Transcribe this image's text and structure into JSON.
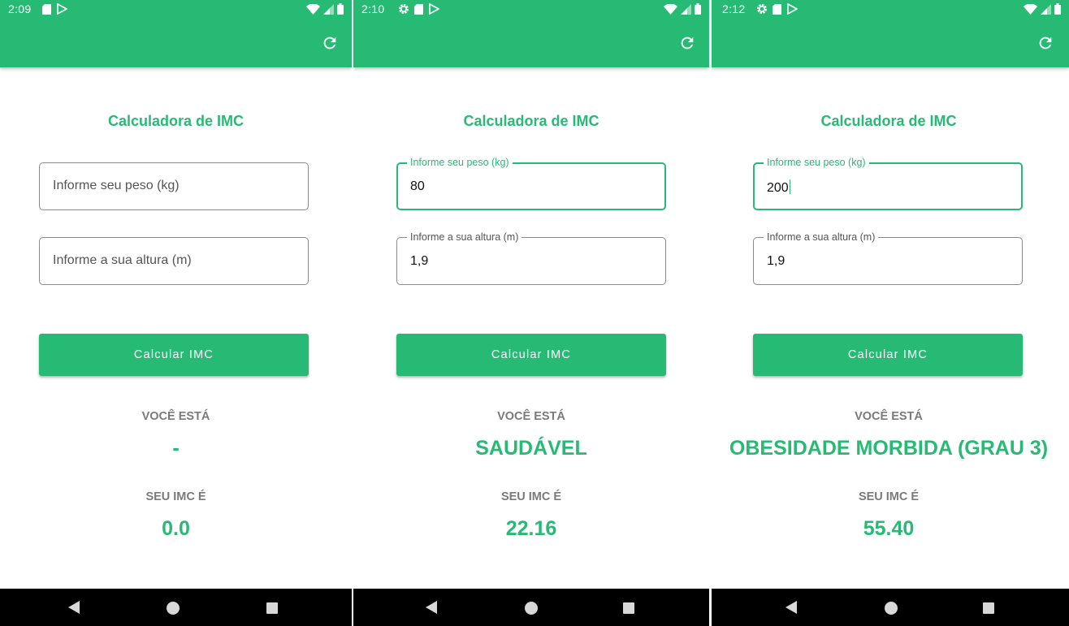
{
  "colors": {
    "primary": "#27ba74",
    "caption": "#7a7a7a",
    "navbar": "#000000"
  },
  "screens": [
    {
      "status_time": "2:09",
      "status_icons": [
        "sd-card-icon",
        "play-store-icon"
      ],
      "title": "Calculadora de IMC",
      "weight": {
        "placeholder": "Informe seu peso (kg)",
        "label": "",
        "value": "",
        "focused": false
      },
      "height": {
        "placeholder": "Informe a sua altura (m)",
        "label": "",
        "value": ""
      },
      "button": "Calcular IMC",
      "status_caption": "VOCÊ ESTÁ",
      "status_value": "-",
      "imc_caption": "SEU IMC É",
      "imc_value": "0.0"
    },
    {
      "status_time": "2:10",
      "status_icons": [
        "gear-icon",
        "sd-card-icon",
        "play-store-icon"
      ],
      "title": "Calculadora de IMC",
      "weight": {
        "placeholder": "",
        "label": "Informe seu peso (kg)",
        "value": "80",
        "focused": true
      },
      "height": {
        "placeholder": "",
        "label": "Informe a sua altura (m)",
        "value": "1,9"
      },
      "button": "Calcular IMC",
      "status_caption": "VOCÊ ESTÁ",
      "status_value": "SAUDÁVEL",
      "imc_caption": "SEU IMC É",
      "imc_value": "22.16"
    },
    {
      "status_time": "2:12",
      "status_icons": [
        "gear-icon",
        "sd-card-icon",
        "play-store-icon"
      ],
      "title": "Calculadora de IMC",
      "weight": {
        "placeholder": "",
        "label": "Informe seu peso (kg)",
        "value": "200",
        "focused": true
      },
      "height": {
        "placeholder": "",
        "label": "Informe a sua altura (m)",
        "value": "1,9"
      },
      "button": "Calcular IMC",
      "status_caption": "VOCÊ ESTÁ",
      "status_value": "OBESIDADE MORBIDA (GRAU 3)",
      "imc_caption": "SEU IMC É",
      "imc_value": "55.40"
    }
  ]
}
